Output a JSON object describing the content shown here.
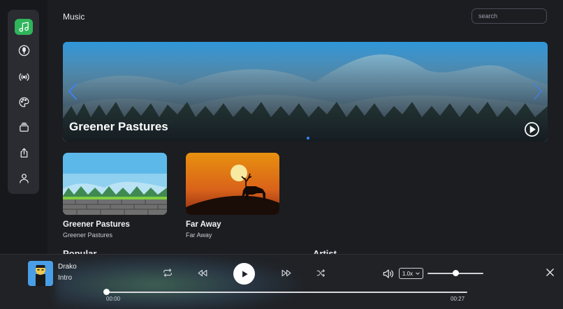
{
  "header": {
    "title": "Music",
    "search_placeholder": "search"
  },
  "sidebar": {
    "items": [
      {
        "icon": "music-note-icon",
        "active": true
      },
      {
        "icon": "microphone-icon",
        "active": false
      },
      {
        "icon": "broadcast-icon",
        "active": false
      },
      {
        "icon": "palette-icon",
        "active": false
      },
      {
        "icon": "albums-icon",
        "active": false
      },
      {
        "icon": "share-icon",
        "active": false
      },
      {
        "icon": "user-icon",
        "active": false
      }
    ],
    "active_color": "#2fb55a"
  },
  "hero": {
    "title": "Greener Pastures",
    "slide_index": 1,
    "slide_count": 1
  },
  "cards": [
    {
      "title": "Greener Pastures",
      "subtitle": "Greener Pastures"
    },
    {
      "title": "Far Away",
      "subtitle": "Far Away"
    }
  ],
  "sections": {
    "popular": "Popular",
    "artist": "Artist"
  },
  "player": {
    "artist": "Drako",
    "track": "Intro",
    "speed": "1.0x",
    "volume": 0.5,
    "progress": 0.0,
    "time_current": "00:00",
    "time_total": "00:27"
  },
  "colors": {
    "accent": "#2fb55a",
    "dot": "#3b82f6",
    "background": "#1b1d21"
  }
}
